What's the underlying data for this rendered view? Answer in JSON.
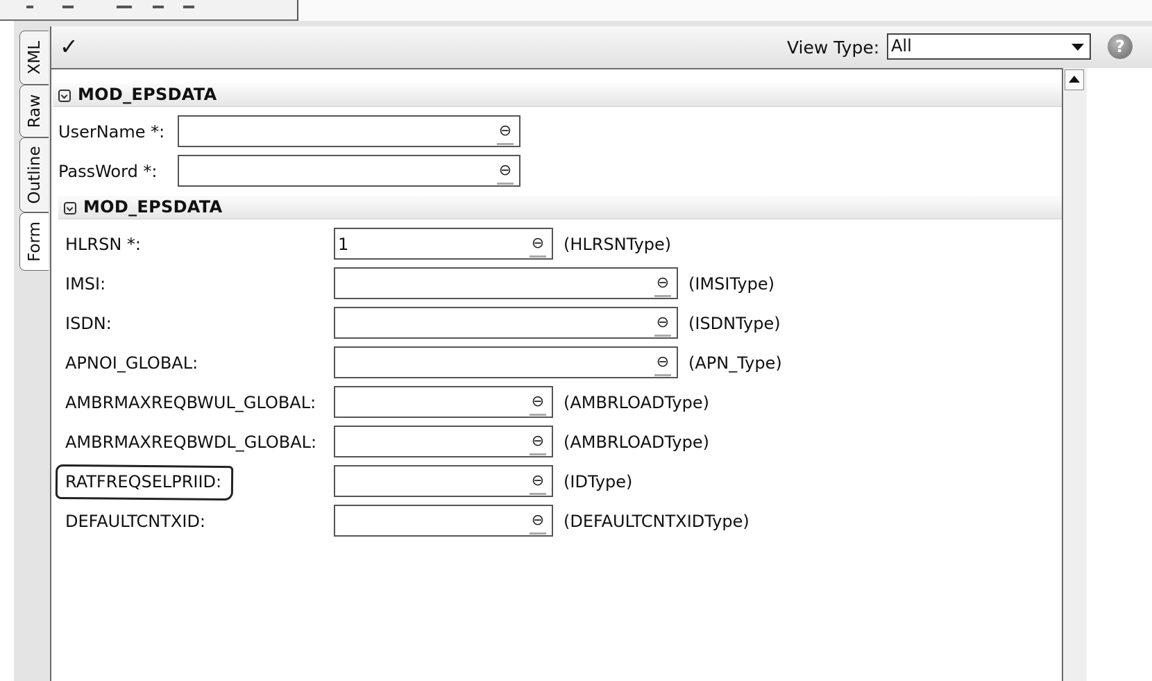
{
  "toolbar": {
    "view_type_label": "View Type:",
    "view_type_selected": "All"
  },
  "side_tabs": [
    "XML",
    "Raw",
    "Outline",
    "Form"
  ],
  "sections": [
    {
      "title": "MOD_EPSDATA",
      "fields": [
        {
          "label": "UserName *:",
          "value": ""
        },
        {
          "label": "PassWord *:",
          "value": ""
        }
      ]
    },
    {
      "title": "MOD_EPSDATA",
      "fields": [
        {
          "label": "HLRSN *:",
          "value": "1",
          "type": "(HLRSNType)"
        },
        {
          "label": "IMSI:",
          "value": "",
          "type": "(IMSIType)"
        },
        {
          "label": "ISDN:",
          "value": "",
          "type": "(ISDNType)"
        },
        {
          "label": "APNOI_GLOBAL:",
          "value": "",
          "type": "(APN_Type)"
        },
        {
          "label": "AMBRMAXREQBWUL_GLOBAL:",
          "value": "",
          "type": "(AMBRLOADType)"
        },
        {
          "label": "AMBRMAXREQBWDL_GLOBAL:",
          "value": "",
          "type": "(AMBRLOADType)"
        },
        {
          "label": "RATFREQSELPRIID:",
          "value": "",
          "type": "(IDType)"
        },
        {
          "label": "DEFAULTCNTXID:",
          "value": "",
          "type": "(DEFAULTCNTXIDType)"
        }
      ]
    }
  ],
  "icons": {
    "check": "✓",
    "help": "?",
    "clear": "⊖"
  }
}
